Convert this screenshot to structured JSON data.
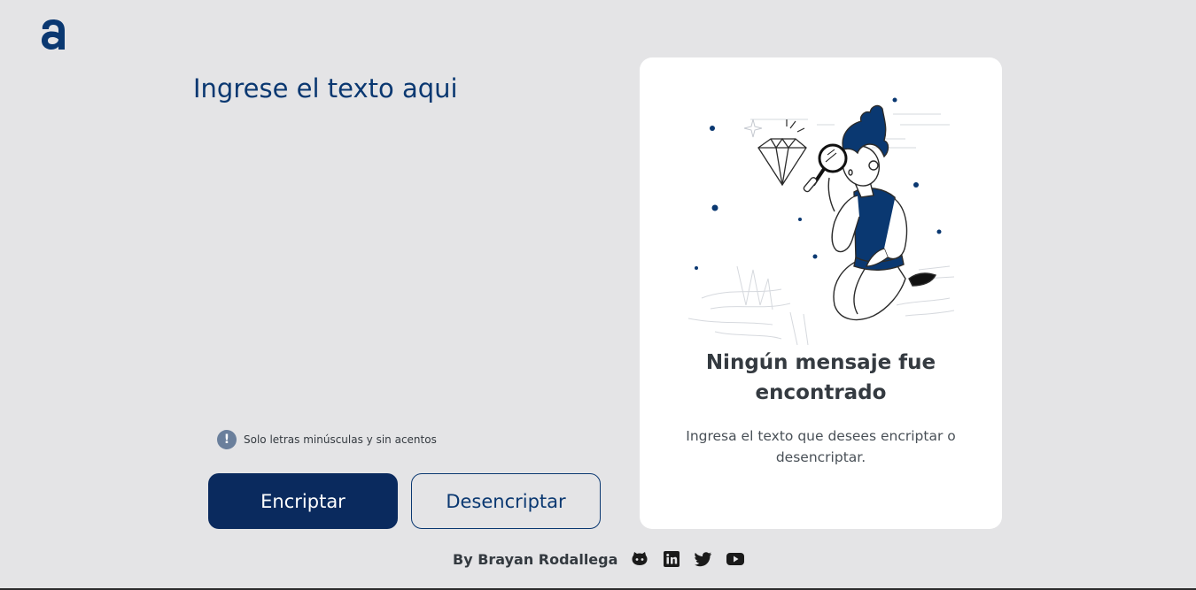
{
  "header": {
    "logo_icon": "alura-logo-icon"
  },
  "input": {
    "placeholder": "Ingrese el texto aqui",
    "value": ""
  },
  "hint": {
    "icon": "exclamation-circle-icon",
    "text": "Solo letras minúsculas y sin acentos"
  },
  "buttons": {
    "encrypt_label": "Encriptar",
    "decrypt_label": "Desencriptar"
  },
  "output_panel": {
    "illustration": "person-with-magnifier-illustration",
    "title": "Ningún mensaje fue encontrado",
    "description": "Ingresa el texto que desees encriptar o desencriptar."
  },
  "footer": {
    "credit": "By Brayan Rodallega",
    "social_icons": [
      "github-icon",
      "linkedin-icon",
      "twitter-icon",
      "youtube-icon"
    ]
  },
  "colors": {
    "background": "#e4e4e6",
    "primary": "#0a3871",
    "button_primary": "#0a2a5e",
    "card": "#ffffff",
    "text_dark": "#343a40"
  }
}
